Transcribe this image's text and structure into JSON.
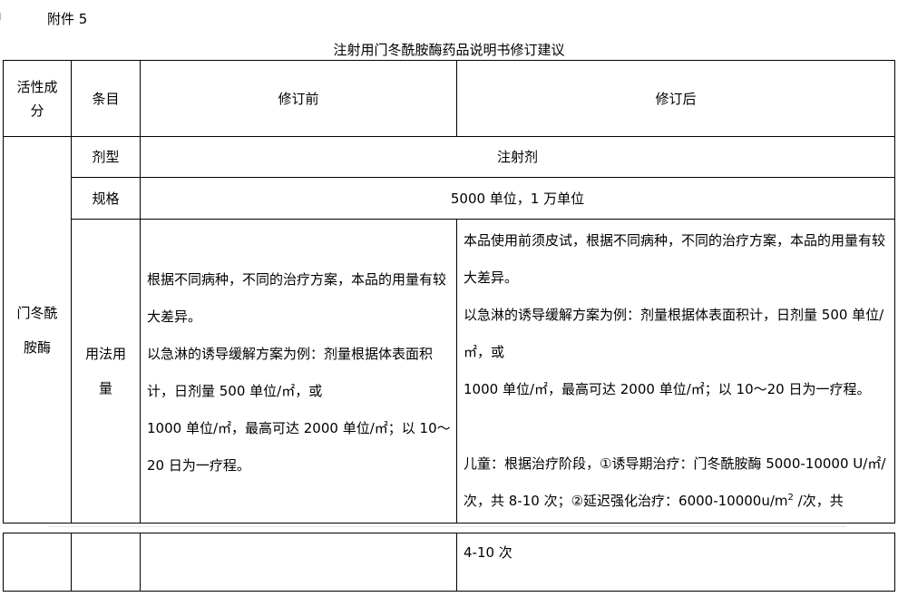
{
  "header": {
    "attachment": "附件 5",
    "title": "注射用门冬酰胺酶药品说明书修订建议"
  },
  "table": {
    "columns": [
      "活性成分",
      "条目",
      "修订前",
      "修订后"
    ],
    "ingredient": "门冬酰胺酶",
    "rows": [
      {
        "item": "剂型",
        "merged_value": "注射剂"
      },
      {
        "item": "规格",
        "merged_value": "5000 单位，1 万单位"
      }
    ],
    "usage": {
      "item": "用法用量",
      "before": [
        "根据不同病种，不同的治疗方案，本品的用量有较大差异。",
        "以急淋的诱导缓解方案为例：剂量根据体表面积计，日剂量 500 单位/㎡，或",
        "1000 单位/㎡，最高可达 2000 单位/㎡；以 10～20 日为一疗程。"
      ],
      "after": [
        "本品使用前须皮试，根据不同病种，不同的治疗方案，本品的用量有较大差异。",
        "以急淋的诱导缓解方案为例：剂量根据体表面积计，日剂量 500 单位/㎡，或",
        "1000 单位/㎡，最高可达 2000 单位/㎡；以 10～20 日为一疗程。",
        "儿童：根据治疗阶段，①诱导期治疗：门冬酰胺酶 5000-10000 U/㎡/次，共 8-10 次；②延迟强化治疗：6000-10000u/m",
        "2",
        " /次，共"
      ]
    },
    "continuation": "4-10  次"
  }
}
